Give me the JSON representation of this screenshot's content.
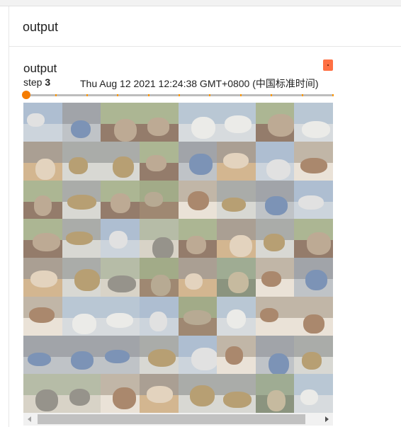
{
  "card": {
    "title": "output"
  },
  "run": {
    "title": "output",
    "step_label": "step",
    "step_value": "3",
    "timestamp": "Thu Aug 12 2021 12:24:38 GMT+0800 (中国标准时间)"
  },
  "colors": {
    "accent": "#f57c00",
    "tick": "#ff9800",
    "badge": "#ff7043",
    "track": "#bdbdbd"
  },
  "slider": {
    "value": 1.0,
    "steps": 11
  },
  "image_grid": {
    "rows": 8,
    "cols": 8,
    "tiles": [
      [
        "airplane",
        "car",
        "horse",
        "horse",
        "ship",
        "ship",
        "horse",
        "ship"
      ],
      [
        "cat",
        "truck",
        "truck",
        "horse",
        "car",
        "cat",
        "airplane",
        "dog"
      ],
      [
        "horse",
        "truck",
        "horse",
        "deer",
        "dog",
        "truck",
        "car",
        "airplane"
      ],
      [
        "horse",
        "truck",
        "airplane",
        "bird",
        "horse",
        "cat",
        "truck",
        "horse"
      ],
      [
        "cat",
        "truck",
        "bird",
        "deer",
        "cat",
        "frog",
        "dog",
        "car"
      ],
      [
        "dog",
        "ship",
        "ship",
        "airplane",
        "deer",
        "ship",
        "dog",
        "dog"
      ],
      [
        "car",
        "car",
        "car",
        "truck",
        "airplane",
        "dog",
        "car",
        "truck"
      ],
      [
        "bird",
        "bird",
        "dog",
        "cat",
        "truck",
        "truck",
        "frog",
        "ship"
      ]
    ]
  }
}
